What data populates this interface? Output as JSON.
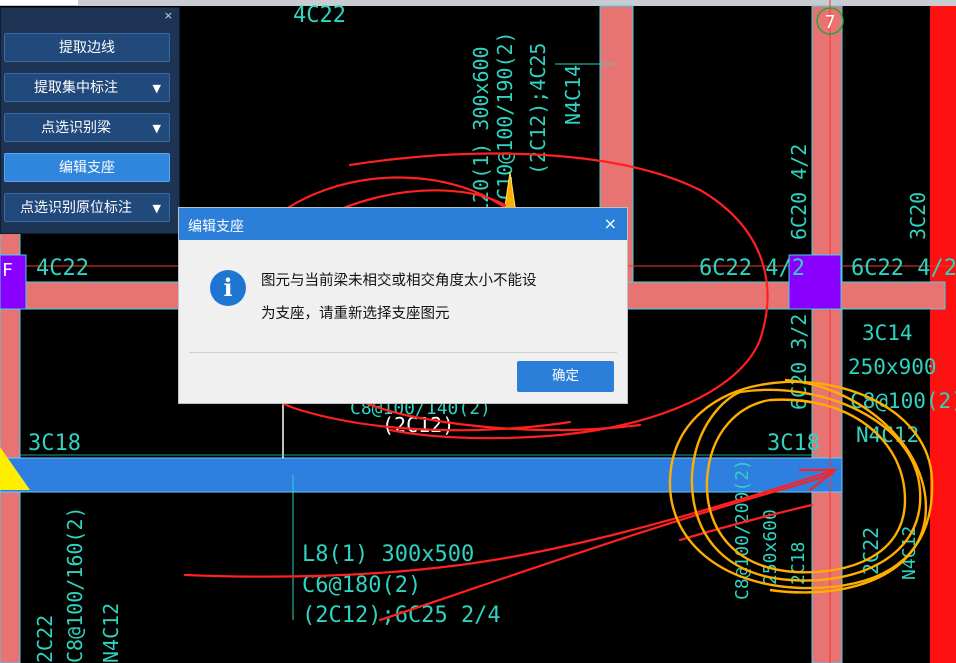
{
  "panel": {
    "close_glyph": "×",
    "buttons": [
      {
        "label": "提取边线",
        "dropdown": false,
        "active": false
      },
      {
        "label": "提取集中标注",
        "dropdown": true,
        "active": false
      },
      {
        "label": "点选识别梁",
        "dropdown": true,
        "active": false
      },
      {
        "label": "编辑支座",
        "dropdown": false,
        "active": true
      },
      {
        "label": "点选识别原位标注",
        "dropdown": true,
        "active": false
      }
    ],
    "dropdown_glyph": "▼"
  },
  "dialog": {
    "title": "编辑支座",
    "close_glyph": "×",
    "icon": "info-icon",
    "message_line1": "图元与当前梁未相交或相交角度太小不能设",
    "message_line2": "为支座，请重新选择支座图元",
    "ok_label": "确定"
  },
  "drawing": {
    "axis_labels": {
      "axis7": "7",
      "axisF": "F"
    },
    "annotations": {
      "top_left": "4C22",
      "left_beam": "4C22",
      "right_beam_left": "6C22 4/2",
      "right_beam_right": "6C22 4/2",
      "center_vertical_1": "L20(1) 300x600",
      "center_vertical_2": "C10@100/190(2)",
      "center_vertical_3": "(2C12);4C25",
      "center_vertical_4": "N4C14",
      "right_vertical_1": "6C20 4/2",
      "right_vertical_2": "3C20",
      "right_block_1": "3C14",
      "right_block_2": "250x900",
      "right_block_3": "C8@100(2)",
      "right_block_4": "N4C12",
      "col_mid_vertical": "6C20 3/2",
      "left_3c18": "3C18",
      "right_3c18": "3C18",
      "under_dialog_1": "C8@100/140(2)",
      "under_dialog_2": "(2C12)",
      "l8_line1": "L8(1) 300x500",
      "l8_line2": "C6@180(2)",
      "l8_line3": "(2C12);6C25 2/4",
      "bottom_left_1": "2C22",
      "bottom_left_2": "C8@100/160(2)",
      "bottom_left_3": "N4C12",
      "bottom_right_1": "C8@100/200(2)",
      "bottom_right_2": "250x600",
      "bottom_right_3": "2C18",
      "bottom_right_4": "2C22",
      "bottom_right_5": "N4C12"
    }
  },
  "colors": {
    "beam": "#e87373",
    "selected_beam": "#2f7fe0",
    "support": "#8a00ff",
    "annotation": "#2fd3c0",
    "ink_red": "#ff2020",
    "ink_orange": "#ffae00",
    "dialog_blue": "#2b7fd8"
  }
}
